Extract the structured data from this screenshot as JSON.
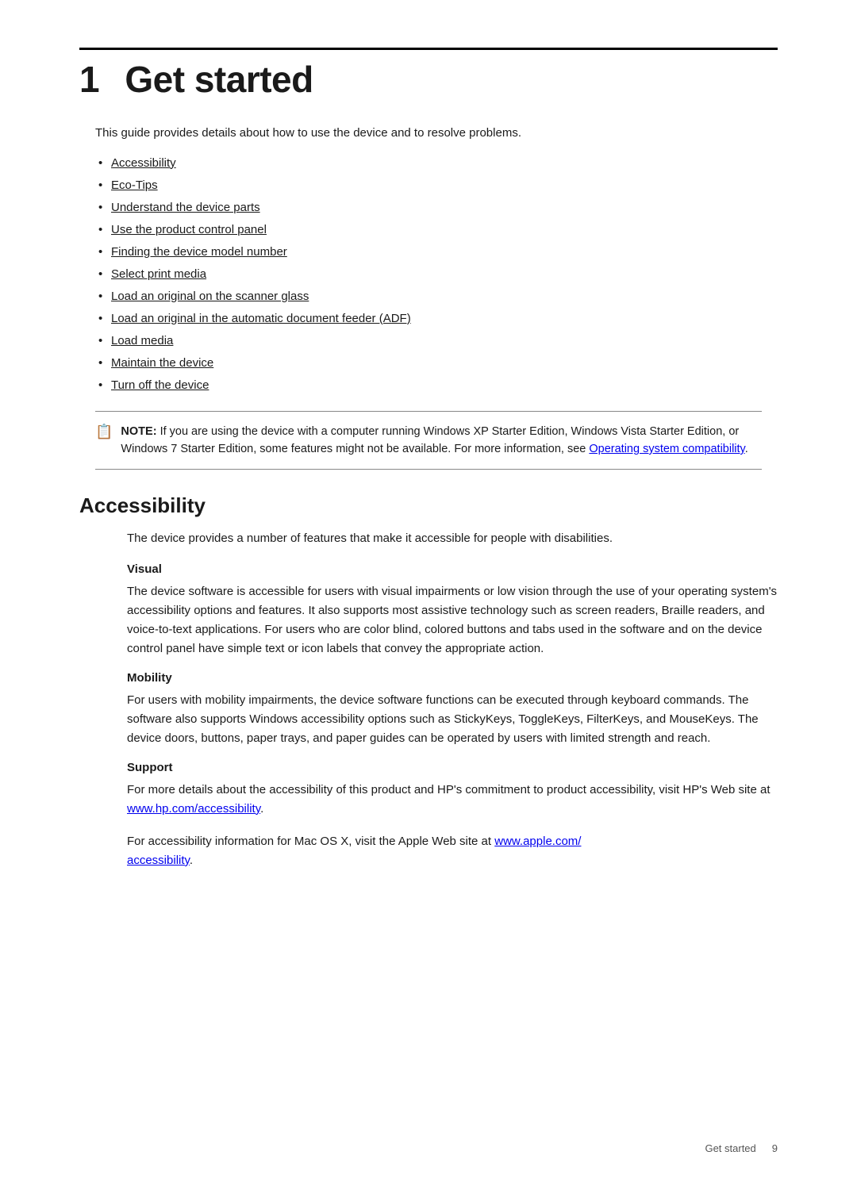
{
  "chapter": {
    "number": "1",
    "title": "Get started",
    "intro": "This guide provides details about how to use the device and to resolve problems."
  },
  "toc_links": [
    {
      "label": "Accessibility",
      "href": "#accessibility"
    },
    {
      "label": "Eco-Tips",
      "href": "#eco-tips"
    },
    {
      "label": "Understand the device parts",
      "href": "#understand"
    },
    {
      "label": "Use the product control panel",
      "href": "#control-panel"
    },
    {
      "label": "Finding the device model number",
      "href": "#model-number"
    },
    {
      "label": "Select print media",
      "href": "#print-media"
    },
    {
      "label": "Load an original on the scanner glass",
      "href": "#scanner-glass"
    },
    {
      "label": "Load an original in the automatic document feeder (ADF)",
      "href": "#adf"
    },
    {
      "label": "Load media",
      "href": "#load-media"
    },
    {
      "label": "Maintain the device",
      "href": "#maintain"
    },
    {
      "label": "Turn off the device",
      "href": "#turn-off"
    }
  ],
  "note": {
    "icon": "📝",
    "label": "NOTE:",
    "text": "If you are using the device with a computer running Windows XP Starter Edition, Windows Vista Starter Edition, or Windows 7 Starter Edition, some features might not be available. For more information, see",
    "link_text": "Operating system compatibility",
    "link_href": "#os-compatibility",
    "text_after": "."
  },
  "accessibility_section": {
    "title": "Accessibility",
    "intro": "The device provides a number of features that make it accessible for people with disabilities.",
    "subsections": [
      {
        "title": "Visual",
        "body": "The device software is accessible for users with visual impairments or low vision through the use of your operating system's accessibility options and features. It also supports most assistive technology such as screen readers, Braille readers, and voice-to-text applications. For users who are color blind, colored buttons and tabs used in the software and on the device control panel have simple text or icon labels that convey the appropriate action."
      },
      {
        "title": "Mobility",
        "body": "For users with mobility impairments, the device software functions can be executed through keyboard commands. The software also supports Windows accessibility options such as StickyKeys, ToggleKeys, FilterKeys, and MouseKeys. The device doors, buttons, paper trays, and paper guides can be operated by users with limited strength and reach."
      },
      {
        "title": "Support",
        "body1": "For more details about the accessibility of this product and HP's commitment to product accessibility, visit HP's Web site at",
        "link1_text": "www.hp.com/accessibility",
        "link1_href": "http://www.hp.com/accessibility",
        "body1_after": ".",
        "body2": "For accessibility information for Mac OS X, visit the Apple Web site at",
        "link2_text": "www.apple.com/\naccessibility",
        "link2_href": "http://www.apple.com/accessibility",
        "body2_after": "."
      }
    ]
  },
  "footer": {
    "label": "Get started",
    "page": "9"
  }
}
